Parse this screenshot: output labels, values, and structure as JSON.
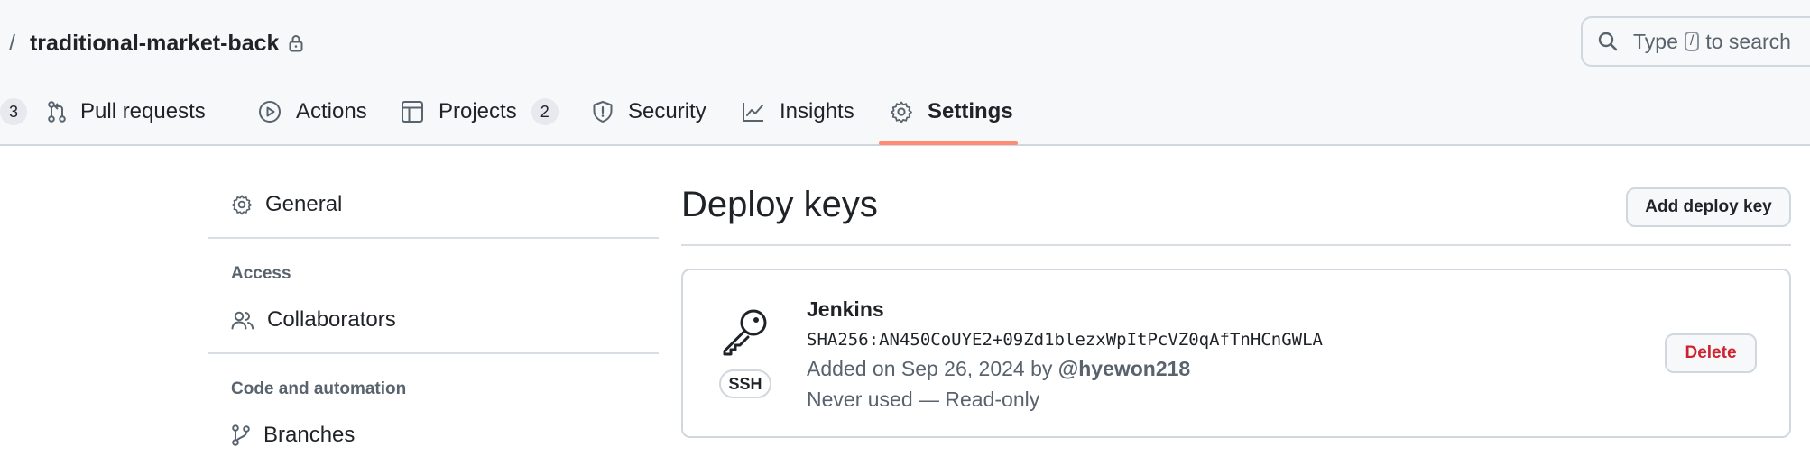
{
  "header": {
    "breadcrumb_separator": "/",
    "repo_name": "traditional-market-back",
    "lock_icon": "lock-icon",
    "search": {
      "prefix": "Type",
      "key": "/",
      "suffix": "to search",
      "icon": "search-icon"
    }
  },
  "nav": {
    "issues_count": "3",
    "tabs": [
      {
        "label": "Pull requests",
        "icon": "git-pull-request-icon"
      },
      {
        "label": "Actions",
        "icon": "play-icon"
      },
      {
        "label": "Projects",
        "icon": "table-icon",
        "count": "2"
      },
      {
        "label": "Security",
        "icon": "shield-icon"
      },
      {
        "label": "Insights",
        "icon": "graph-icon"
      },
      {
        "label": "Settings",
        "icon": "gear-icon",
        "selected": true
      }
    ],
    "selected_underline_color": "#fd8c73"
  },
  "sidebar": {
    "general": {
      "label": "General",
      "icon": "gear-icon"
    },
    "sections": [
      {
        "heading": "Access",
        "items": [
          {
            "label": "Collaborators",
            "icon": "people-icon"
          }
        ]
      },
      {
        "heading": "Code and automation",
        "items": [
          {
            "label": "Branches",
            "icon": "git-branch-icon"
          }
        ]
      }
    ]
  },
  "main": {
    "title": "Deploy keys",
    "add_button_label": "Add deploy key",
    "keys": [
      {
        "name": "Jenkins",
        "type_badge": "SSH",
        "fingerprint": "SHA256:AN450CoUYE2+09Zd1blezxWpItPcVZ0qAfTnHCnGWLA",
        "added_prefix": "Added on Sep 26, 2024 by",
        "added_by": "@hyewon218",
        "usage": "Never used — Read-only",
        "delete_label": "Delete",
        "icon": "key-icon"
      }
    ]
  },
  "colors": {
    "danger": "#cf222e",
    "muted_text": "#59636e",
    "border": "#d0d7de",
    "header_bg": "#f6f8fa"
  }
}
